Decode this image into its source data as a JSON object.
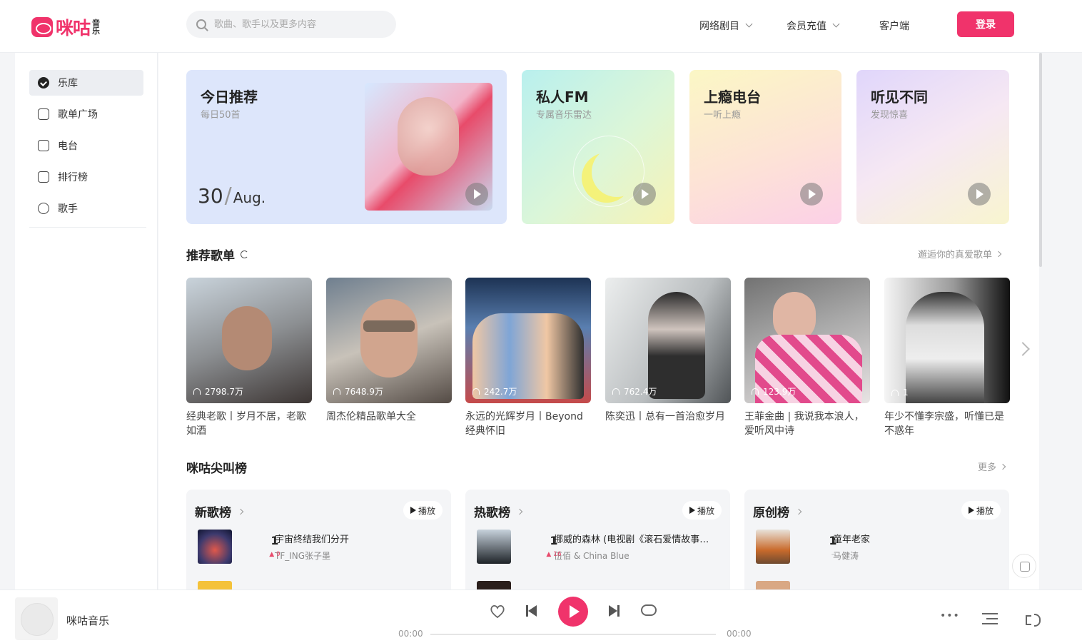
{
  "header": {
    "logo_text": "咪咕",
    "logo_sub": "音乐",
    "search_placeholder": "歌曲、歌手以及更多内容",
    "nav": [
      "网络剧目",
      "会员充值",
      "客户端"
    ],
    "login": "登录"
  },
  "sidebar": {
    "items": [
      {
        "label": "乐库",
        "icon": "music-library-icon"
      },
      {
        "label": "歌单广场",
        "icon": "playlist-icon"
      },
      {
        "label": "电台",
        "icon": "radio-icon"
      },
      {
        "label": "排行榜",
        "icon": "chart-icon"
      },
      {
        "label": "歌手",
        "icon": "singer-icon"
      }
    ]
  },
  "cards": [
    {
      "title": "今日推荐",
      "sub": "每日50首",
      "day": "30",
      "month": "Aug."
    },
    {
      "title": "私人FM",
      "sub": "专属音乐雷达"
    },
    {
      "title": "上瘾电台",
      "sub": "一听上瘾"
    },
    {
      "title": "听见不同",
      "sub": "发现惊喜"
    }
  ],
  "recommend": {
    "title": "推荐歌单",
    "more": "邂逅你的真爱歌单",
    "playlists": [
      {
        "count": "2798.7万",
        "name": "经典老歌丨岁月不居，老歌如酒"
      },
      {
        "count": "7648.9万",
        "name": "周杰伦精品歌单大全"
      },
      {
        "count": "242.7万",
        "name": "永远的光辉岁月丨Beyond经典怀旧"
      },
      {
        "count": "762.4万",
        "name": "陈奕迅丨总有一首治愈岁月"
      },
      {
        "count": "123.9万",
        "name": "王菲金曲 | 我说我本浪人，爱听风中诗"
      },
      {
        "count": "1",
        "name": "年少不懂李宗盛，听懂已是不惑年"
      }
    ]
  },
  "charts_section": {
    "title": "咪咕尖叫榜",
    "more": "更多",
    "play_label": "播放",
    "charts": [
      {
        "title": "新歌榜",
        "rank": "1",
        "trend": "▲ 9",
        "song": "宇宙终结我们分开",
        "artist": "TF_ING张子墨"
      },
      {
        "title": "热歌榜",
        "rank": "1",
        "trend": "▲ 16",
        "song": "挪威的森林 (电视剧《滚石爱情故事》…",
        "artist": "伍佰 & China Blue"
      },
      {
        "title": "原创榜",
        "rank": "1",
        "trend": "–",
        "song": "童年老家",
        "artist": "马健涛"
      }
    ]
  },
  "player": {
    "title": "咪咕音乐",
    "time_current": "00:00",
    "time_total": "00:00"
  },
  "colors": {
    "accent": "#f0336b"
  }
}
